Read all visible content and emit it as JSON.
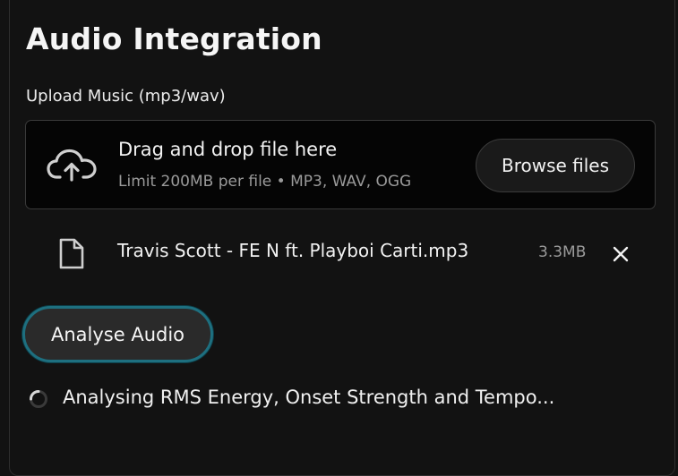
{
  "section": {
    "title": "Audio Integration",
    "upload_label": "Upload Music (mp3/wav)"
  },
  "dropzone": {
    "title": "Drag and drop file here",
    "limit": "Limit 200MB per file • MP3, WAV, OGG",
    "browse_label": "Browse files",
    "icon": "cloud-upload-icon"
  },
  "file": {
    "name": "Travis Scott - FE N ft. Playboi Carti.mp3",
    "size": "3.3MB",
    "icon": "file-icon",
    "remove_icon": "close-icon"
  },
  "actions": {
    "analyse_label": "Analyse Audio",
    "accent": "#1e6f7f"
  },
  "status": {
    "text": "Analysing RMS Energy, Onset Strength and Tempo...",
    "icon": "spinner-icon"
  }
}
